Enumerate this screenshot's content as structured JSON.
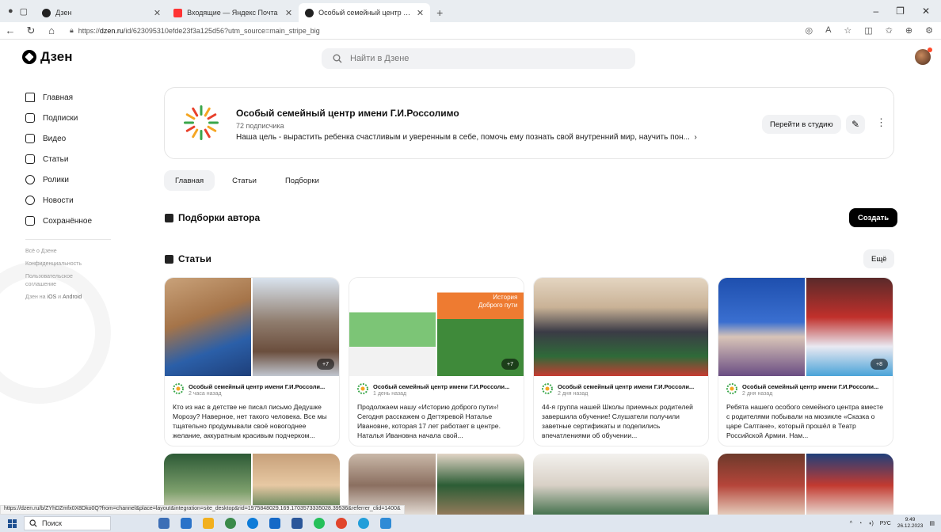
{
  "browser": {
    "tabs": [
      {
        "title": "Дзен",
        "active": false
      },
      {
        "title": "Входящие — Яндекс Почта",
        "active": false
      },
      {
        "title": "Особый семейный центр имени",
        "active": true
      }
    ],
    "url_prefix": "https://",
    "url_host": "dzen.ru",
    "url_rest": "/id/623095310efde23f3a125d56?utm_source=main_stripe_big",
    "status_url": "https://dzen.ru/b/ZYhDZmfx0X8Dko0Q?from=channel&place=layout&integration=site_desktop&rid=1975848029.169.1703573335028.39536&referrer_clid=1400&"
  },
  "header": {
    "logo_text": "Дзен",
    "search_placeholder": "Найти в Дзене"
  },
  "sidebar": {
    "items": [
      {
        "label": "Главная",
        "icon": "home-icon"
      },
      {
        "label": "Подписки",
        "icon": "subscriptions-icon"
      },
      {
        "label": "Видео",
        "icon": "video-icon"
      },
      {
        "label": "Статьи",
        "icon": "articles-icon"
      },
      {
        "label": "Ролики",
        "icon": "shorts-icon"
      },
      {
        "label": "Новости",
        "icon": "news-icon"
      },
      {
        "label": "Сохранённое",
        "icon": "bookmark-icon"
      }
    ],
    "footer": [
      "Всё о Дзене",
      "Конфиденциальность",
      "Пользовательское соглашение"
    ],
    "apps_prefix": "Дзен на ",
    "apps_ios": "iOS",
    "apps_and": " и ",
    "apps_android": "Android"
  },
  "channel": {
    "name": "Особый семейный центр имени Г.И.Россолимо",
    "subscribers": "72 подписчика",
    "description": "Наша цель - вырастить ребенка счастливым и уверенным в себе, помочь ему познать свой внутренний мир, научить пон...",
    "studio_button": "Перейти в студию"
  },
  "page_tabs": [
    "Главная",
    "Статьи",
    "Подборки"
  ],
  "collections": {
    "title": "Подборки автора",
    "create_button": "Создать"
  },
  "articles": {
    "title": "Статьи",
    "more_button": "Ещё",
    "items": [
      {
        "author": "Особый семейный центр имени Г.И.Россоли...",
        "time": "2 часа назад",
        "text": "Кто из нас в детстве не писал письмо Дедушке Морозу? Наверное, нет такого человека. Все мы тщательно продумывали своё новогоднее желание, аккуратным красивым подчерком...",
        "extra": "+7"
      },
      {
        "author": "Особый семейный центр имени Г.И.Россоли...",
        "time": "1 день назад",
        "text": "Продолжаем нашу «Историю доброго пути»! Сегодня расскажем о Дегтяревой Наталье Ивановне, которая 17 лет работает в центре. Наталья Ивановна начала свой...",
        "extra": "+7"
      },
      {
        "author": "Особый семейный центр имени Г.И.Россоли...",
        "time": "2 дня назад",
        "text": "44-я группа нашей Школы приемных родителей завершила обучение! Слушатели получили заветные сертификаты и поделились впечатлениями об обучении...",
        "extra": ""
      },
      {
        "author": "Особый семейный центр имени Г.И.Россоли...",
        "time": "2 дня назад",
        "text": "Ребята нашего особого семейного центра вместе с родителями побывали на мюзикле «Сказка о царе Салтане», который прошёл в Театр Российской Армии. Нам...",
        "extra": "+8"
      }
    ],
    "thumb_overlay_text": "История\nДоброго пути"
  },
  "taskbar": {
    "search_label": "Поиск",
    "lang": "РУС",
    "time": "9:49",
    "date": "26.12.2023"
  },
  "colors": {
    "accent_dark": "#000000",
    "chip_bg": "#f1f2f4",
    "border": "#e5e5e5"
  }
}
